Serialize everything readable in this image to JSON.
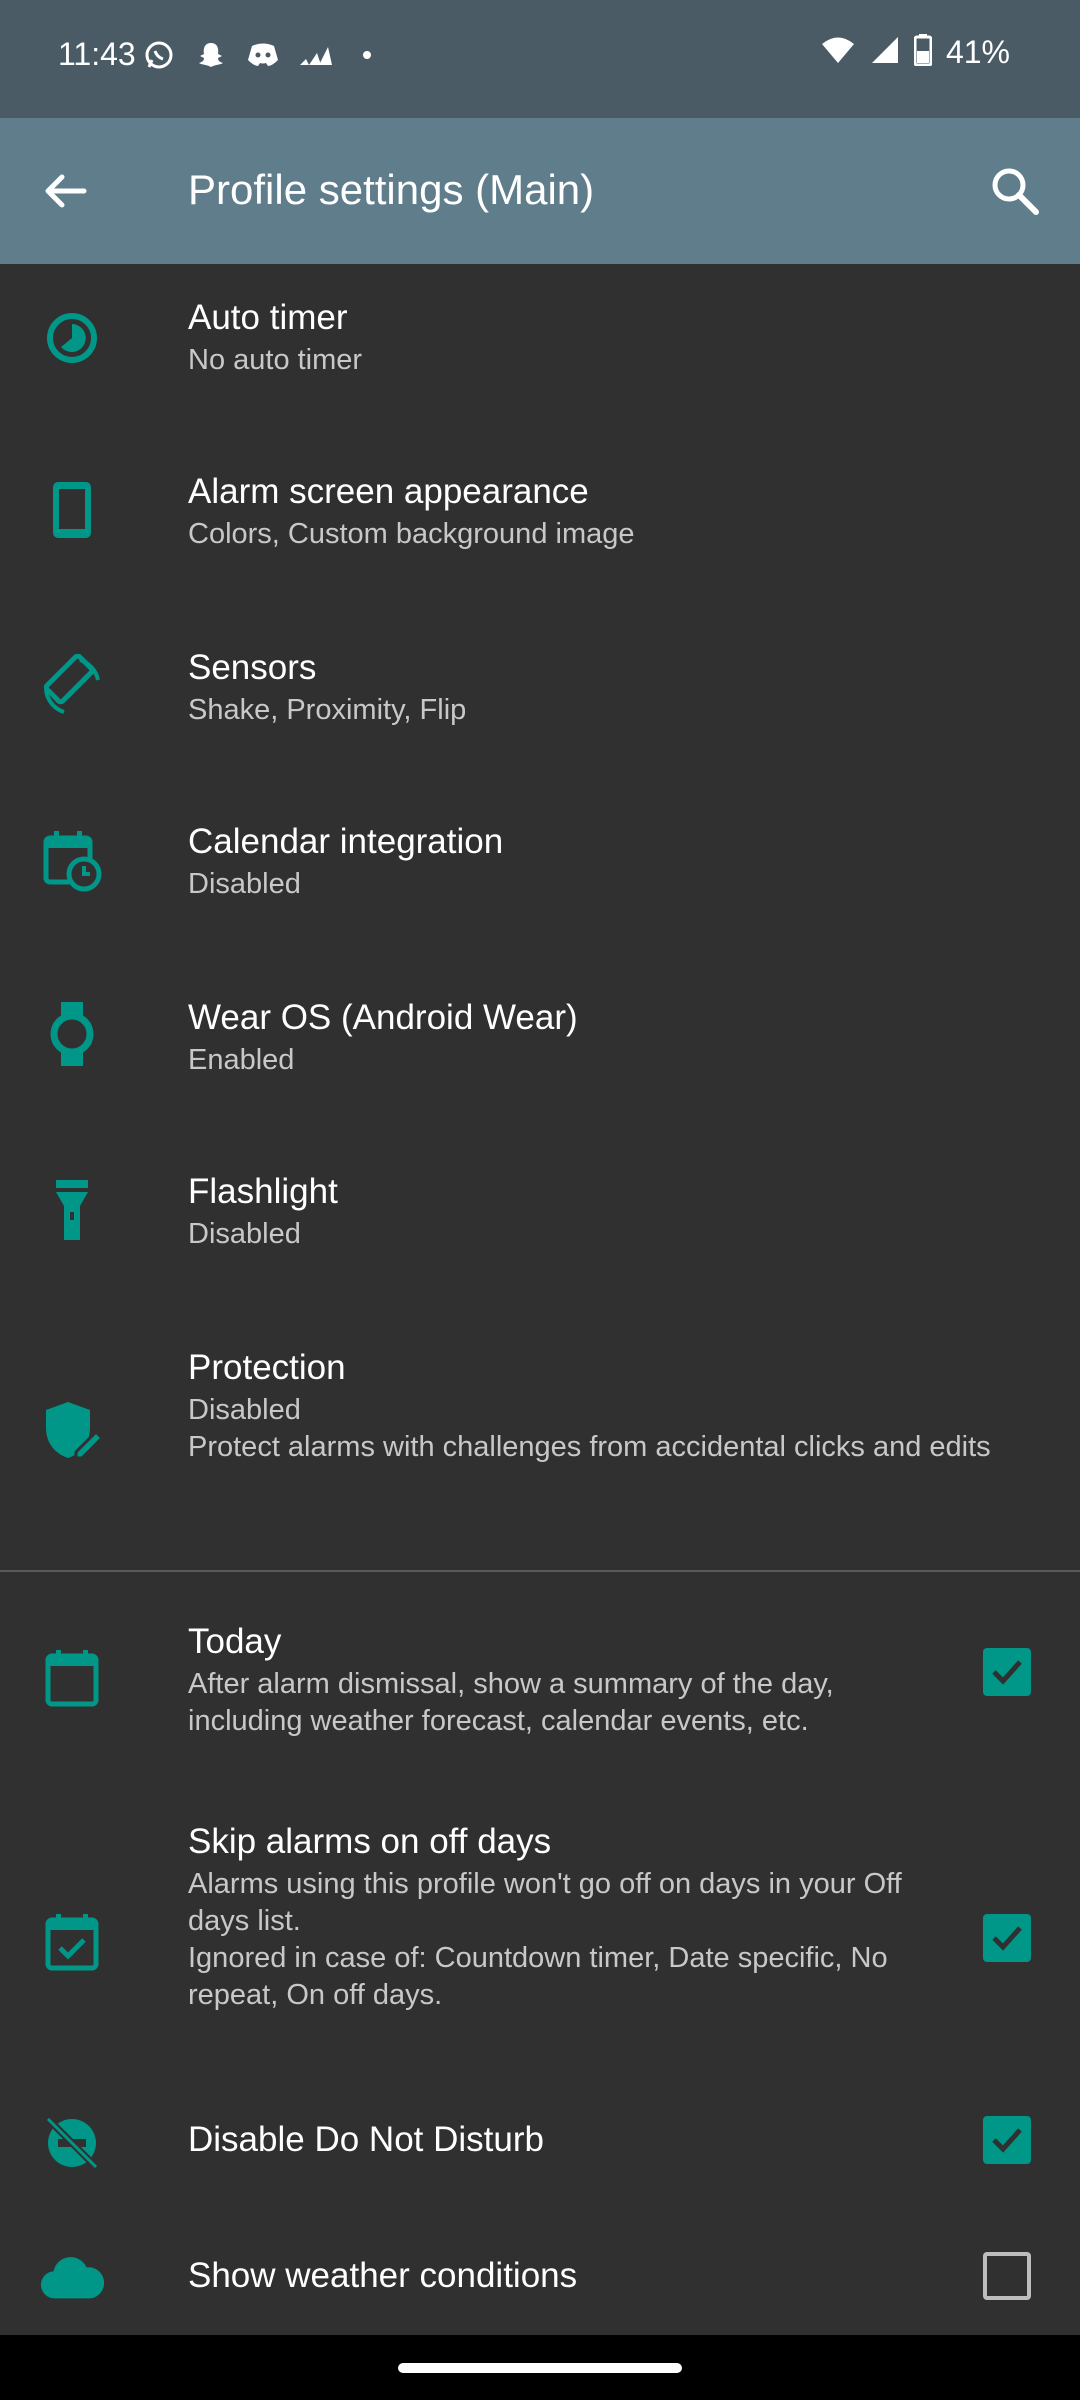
{
  "status_bar": {
    "time": "11:43",
    "battery": "41%",
    "notification_icons": [
      "whatsapp-icon",
      "snapchat-icon",
      "discord-icon",
      "adidas-icon",
      "dot-icon"
    ]
  },
  "app_bar": {
    "title": "Profile settings (Main)"
  },
  "accent_color": "#009688",
  "items": [
    {
      "icon": "auto-timer-icon",
      "title": "Auto timer",
      "subtitle": "No auto timer"
    },
    {
      "icon": "phone-icon",
      "title": "Alarm screen appearance",
      "subtitle": "Colors, Custom background image"
    },
    {
      "icon": "screen-rotation-icon",
      "title": "Sensors",
      "subtitle": "Shake, Proximity, Flip"
    },
    {
      "icon": "calendar-clock-icon",
      "title": "Calendar integration",
      "subtitle": "Disabled"
    },
    {
      "icon": "watch-icon",
      "title": "Wear OS (Android Wear)",
      "subtitle": "Enabled"
    },
    {
      "icon": "flashlight-icon",
      "title": "Flashlight",
      "subtitle": "Disabled"
    },
    {
      "icon": "shield-edit-icon",
      "title": "Protection",
      "subtitle": "Disabled",
      "detail": "Protect alarms with challenges from accidental clicks and edits"
    }
  ],
  "toggles": [
    {
      "icon": "calendar-today-icon",
      "title": "Today",
      "subtitle": "After alarm dismissal, show a summary of the day, including weather forecast, calendar events, etc.",
      "checked": true
    },
    {
      "icon": "calendar-check-icon",
      "title": "Skip alarms on off days",
      "subtitle": "Alarms using this profile won't go off on days in your Off days list.",
      "detail": "Ignored in case of: Countdown timer, Date specific, No repeat, On off days.",
      "checked": true
    },
    {
      "icon": "do-not-disturb-off-icon",
      "title": "Disable Do Not Disturb",
      "checked": true
    },
    {
      "icon": "cloud-icon",
      "title": "Show weather conditions",
      "checked": false
    }
  ]
}
